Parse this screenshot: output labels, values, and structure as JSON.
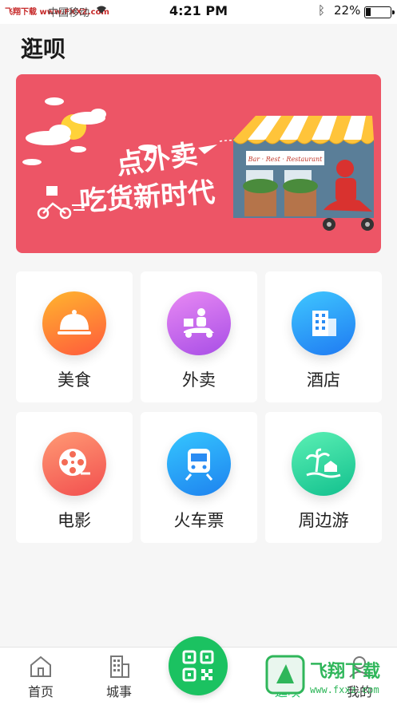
{
  "status_bar": {
    "watermark": "飞翔下载 www.FXXZ.com",
    "carrier": "中国移动",
    "time": "4:21 PM",
    "battery": "22%",
    "battery_level": 0.22
  },
  "page": {
    "title": "逛呗"
  },
  "banner": {
    "headline": "点外卖",
    "subline": "吃货新时代",
    "shop_sign": "Bar · Rest · Restaurant"
  },
  "services": [
    {
      "label": "美食",
      "icon": "food-cloche-icon",
      "color_from": "#ffb52e",
      "color_to": "#ff5a3c"
    },
    {
      "label": "外卖",
      "icon": "delivery-scooter-icon",
      "color_from": "#e889f3",
      "color_to": "#a84ee6"
    },
    {
      "label": "酒店",
      "icon": "hotel-building-icon",
      "color_from": "#3fc7ff",
      "color_to": "#1f7af2"
    },
    {
      "label": "电影",
      "icon": "film-reel-icon",
      "color_from": "#ff9a74",
      "color_to": "#f24f4f"
    },
    {
      "label": "火车票",
      "icon": "train-icon",
      "color_from": "#35c6ff",
      "color_to": "#1e82ef"
    },
    {
      "label": "周边游",
      "icon": "island-palm-icon",
      "color_from": "#5bf0b4",
      "color_to": "#12c08e"
    }
  ],
  "tabbar": {
    "items": [
      {
        "label": "首页",
        "icon": "home-icon"
      },
      {
        "label": "城事",
        "icon": "city-building-icon"
      },
      {
        "label": "",
        "icon": "qr-scan-icon"
      },
      {
        "label": "逛呗",
        "icon": "shopping-bag-icon"
      },
      {
        "label": "我的",
        "icon": "user-icon"
      }
    ]
  },
  "site_watermark": {
    "title": "飞翔下载",
    "url": "www.fxxz.com"
  },
  "colors": {
    "banner": "#ed5566",
    "accent": "#1bc261"
  }
}
